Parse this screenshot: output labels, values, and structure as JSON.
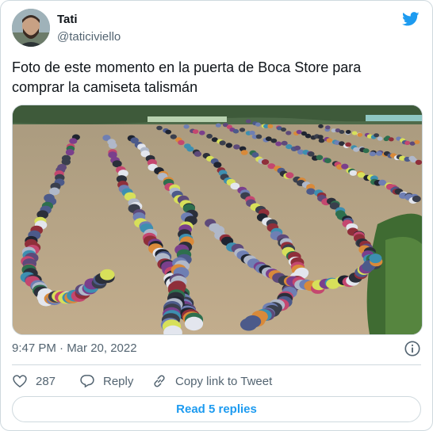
{
  "tweet": {
    "author_name": "Tati",
    "author_handle": "@taticiviello",
    "text": "Foto de este momento en la puerta de Boca Store para comprar la camiseta talismán",
    "timestamp": "9:47 PM · Mar 20, 2022"
  },
  "actions": {
    "like_count": "287",
    "reply_label": "Reply",
    "copy_link_label": "Copy link to Tweet",
    "read_replies_label": "Read 5 replies"
  },
  "icons": {
    "brand": "twitter-bird-icon",
    "info": "info-icon",
    "like": "heart-icon",
    "reply": "speech-bubble-icon",
    "copy": "link-icon"
  },
  "colors": {
    "brand_blue": "#1d9bf0",
    "text_primary": "#0f1419",
    "text_secondary": "#536471",
    "border": "#cfd9de"
  }
}
